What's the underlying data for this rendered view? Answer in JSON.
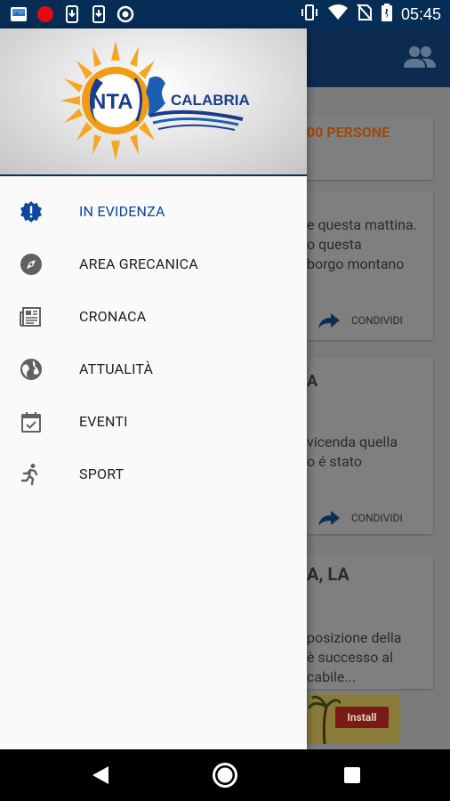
{
  "status_bar": {
    "time": "05:45",
    "left_icons": [
      "photo-icon",
      "record-icon",
      "download-icon",
      "download-icon",
      "sync-icon"
    ],
    "right_icons": [
      "vibrate-icon",
      "wifi-icon",
      "no-sim-icon",
      "battery-icon"
    ]
  },
  "background": {
    "toolbar_icon": "people-icon",
    "card1": {
      "title_fragment": "00 PERSONE"
    },
    "card2": {
      "lines": [
        "e questa mattina.",
        "o questa",
        "borgo montano"
      ],
      "share_label": "CONDIVIDI"
    },
    "card3": {
      "title_fragment": "A",
      "lines": [
        "vicenda quella",
        "o é stato"
      ],
      "share_label": "CONDIVIDI"
    },
    "card4": {
      "title_fragment": "A, LA",
      "lines": [
        "posizione della",
        "è successo al",
        "cabile..."
      ]
    },
    "ad": {
      "button_label": "Install"
    }
  },
  "drawer": {
    "logo": {
      "left_text": "NTA",
      "right_text": "CALABRIA"
    },
    "items": [
      {
        "label": "IN EVIDENZA",
        "icon": "badge-alert-icon",
        "active": true
      },
      {
        "label": "AREA GRECANICA",
        "icon": "compass-icon",
        "active": false
      },
      {
        "label": "CRONACA",
        "icon": "newspaper-icon",
        "active": false
      },
      {
        "label": "ATTUALITÀ",
        "icon": "globe-icon",
        "active": false
      },
      {
        "label": "EVENTI",
        "icon": "calendar-check-icon",
        "active": false
      },
      {
        "label": "SPORT",
        "icon": "runner-icon",
        "active": false
      }
    ]
  },
  "colors": {
    "primary": "#062d56",
    "active": "#0d47a1",
    "accent": "#e65100"
  }
}
